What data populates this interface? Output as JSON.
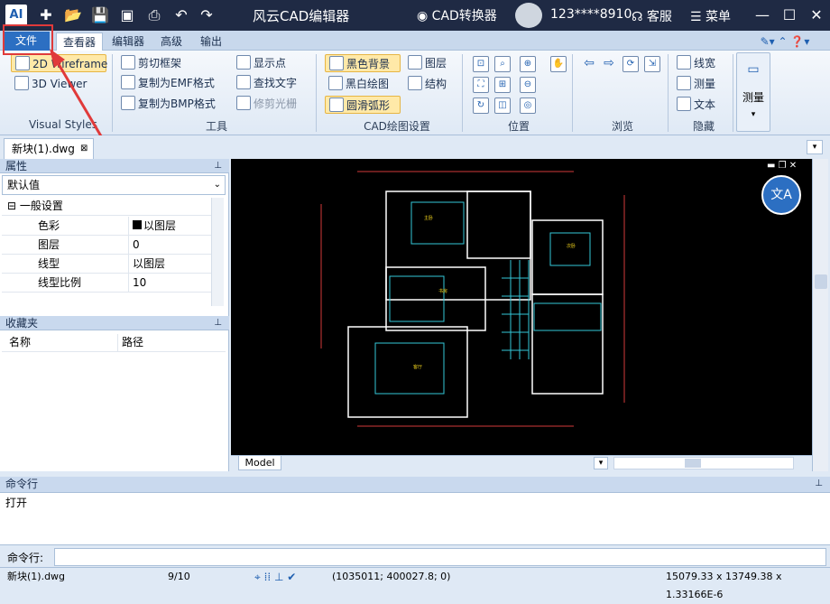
{
  "app": {
    "logo_text": "AI",
    "title": "风云CAD编辑器",
    "converter_label": "CAD转换器",
    "phone": "123****8910",
    "service_label": "客服",
    "menu_label": "菜单"
  },
  "tabs": [
    "文件",
    "查看器",
    "编辑器",
    "高级",
    "输出"
  ],
  "ribbon": {
    "visual_styles": {
      "items": [
        "2D Wireframe",
        "3D Viewer"
      ],
      "label": "Visual Styles"
    },
    "tools": {
      "items": [
        "剪切框架",
        "复制为EMF格式",
        "复制为BMP格式",
        "显示点",
        "查找文字",
        "修剪光栅"
      ],
      "label": "工具"
    },
    "cad_settings": {
      "items": [
        "黑色背景",
        "黑白绘图",
        "圆滑弧形",
        "图层",
        "结构"
      ],
      "label": "CAD绘图设置"
    },
    "position": {
      "label": "位置"
    },
    "browse": {
      "label": "浏览"
    },
    "hidden": {
      "items": [
        "线宽",
        "测量",
        "文本"
      ],
      "label": "隐藏"
    },
    "measure_label": "测量"
  },
  "document": {
    "tab": "新块(1).dwg"
  },
  "properties": {
    "title": "属性",
    "dropdown": "默认值",
    "group": "一般设置",
    "rows": [
      {
        "key": "色彩",
        "value": "以图层"
      },
      {
        "key": "图层",
        "value": "0"
      },
      {
        "key": "线型",
        "value": "以图层"
      },
      {
        "key": "线型比例",
        "value": "10"
      }
    ]
  },
  "favorites": {
    "title": "收藏夹",
    "col_name": "名称",
    "col_path": "路径"
  },
  "model_tab": "Model",
  "command": {
    "title": "命令行",
    "output": "打开",
    "input_label": "命令行:"
  },
  "status": {
    "file": "新块(1).dwg",
    "page": "9/10",
    "coords": "(1035011; 400027.8; 0)",
    "size": "15079.33 x 13749.38 x 1.33166E-6"
  },
  "colors": {
    "accent": "#2c6fc2",
    "highlight": "#e03a3a",
    "titlebar": "#1f2a44"
  }
}
